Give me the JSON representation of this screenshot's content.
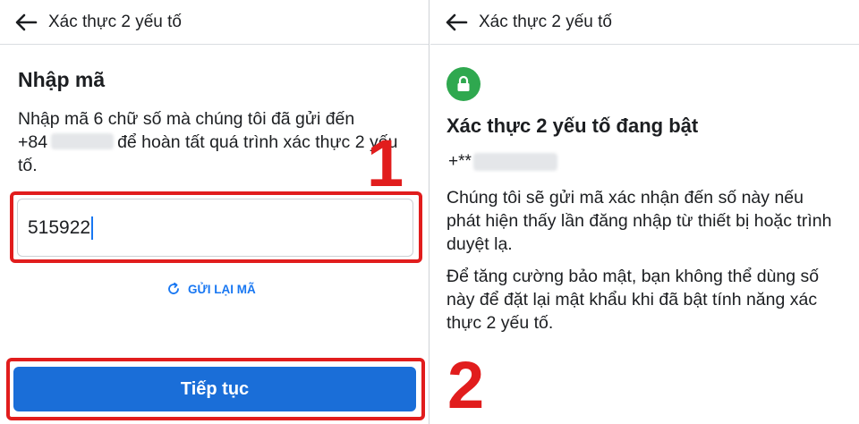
{
  "left": {
    "header": {
      "title": "Xác thực 2 yếu tố"
    },
    "heading": "Nhập mã",
    "description_line1": "Nhập mã 6 chữ số mà chúng tôi đã gửi đến",
    "phone_prefix": "+84",
    "description_rest": "để hoàn tất quá trình xác thực 2 yếu tố.",
    "code_value": "515922",
    "resend_label": "GỬI LẠI MÃ",
    "continue_label": "Tiếp tục",
    "step_number": "1"
  },
  "right": {
    "header": {
      "title": "Xác thực 2 yếu tố"
    },
    "heading": "Xác thực 2 yếu tố đang bật",
    "phone_prefix": "+**",
    "paragraph1": "Chúng tôi sẽ gửi mã xác nhận đến số này nếu phát hiện thấy lần đăng nhập từ thiết bị hoặc trình duyệt lạ.",
    "paragraph2": "Để tăng cường bảo mật, bạn không thể dùng số này để đặt lại mật khẩu khi đã bật tính năng xác thực 2 yếu tố.",
    "step_number": "2"
  },
  "colors": {
    "accent": "#1877f2",
    "button": "#1a6ed8",
    "highlight": "#e11d1d",
    "lock": "#2fa84f"
  },
  "icons": {
    "back": "arrow-left-icon",
    "resend": "refresh-icon",
    "lock": "lock-icon"
  }
}
